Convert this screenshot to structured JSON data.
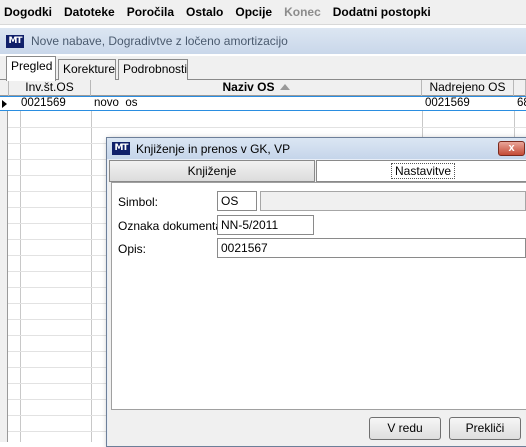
{
  "menu": {
    "items": [
      {
        "label": "Dogodki",
        "disabled": false
      },
      {
        "label": "Datoteke",
        "disabled": false
      },
      {
        "label": "Poročila",
        "disabled": false
      },
      {
        "label": "Ostalo",
        "disabled": false
      },
      {
        "label": "Opcije",
        "disabled": false
      },
      {
        "label": "Konec",
        "disabled": true
      },
      {
        "label": "Dodatni postopki",
        "disabled": false
      }
    ]
  },
  "window": {
    "logo": "MT",
    "title": "Nove nabave, Dogradivtve z ločeno amortizacijo"
  },
  "tabs": {
    "pregled": "Pregled",
    "korekture": "Korekture",
    "podrobnosti": "Podrobnosti"
  },
  "grid": {
    "columns": {
      "inv": "Inv.št.OS",
      "naziv": "Naziv OS",
      "nadrejeno": "Nadrejeno OS"
    },
    "sort_column": "naziv",
    "sort_direction": "ascending",
    "rows": [
      {
        "inv": "0021569",
        "naziv": "novo  os",
        "nadrejeno": "0021569",
        "extra": "68"
      }
    ]
  },
  "dialog": {
    "logo": "MT",
    "title": "Knjiženje in prenos v GK, VP",
    "close_label": "x",
    "tabs": {
      "knjizenje": "Knjiženje",
      "nastavitve": "Nastavitve",
      "active": "nastavitve"
    },
    "fields": {
      "simbol_label": "Simbol:",
      "simbol_value": "OS",
      "simbol_extra": "",
      "oznaka_label": "Oznaka dokumenta:",
      "oznaka_value": "NN-5/2011",
      "opis_label": "Opis:",
      "opis_value": "0021567"
    },
    "buttons": {
      "ok": "V redu",
      "cancel": "Prekliči"
    }
  },
  "colors": {
    "selection_border": "#2a8de0",
    "close_button": "#c44a35",
    "logo_bg": "#10206a"
  }
}
